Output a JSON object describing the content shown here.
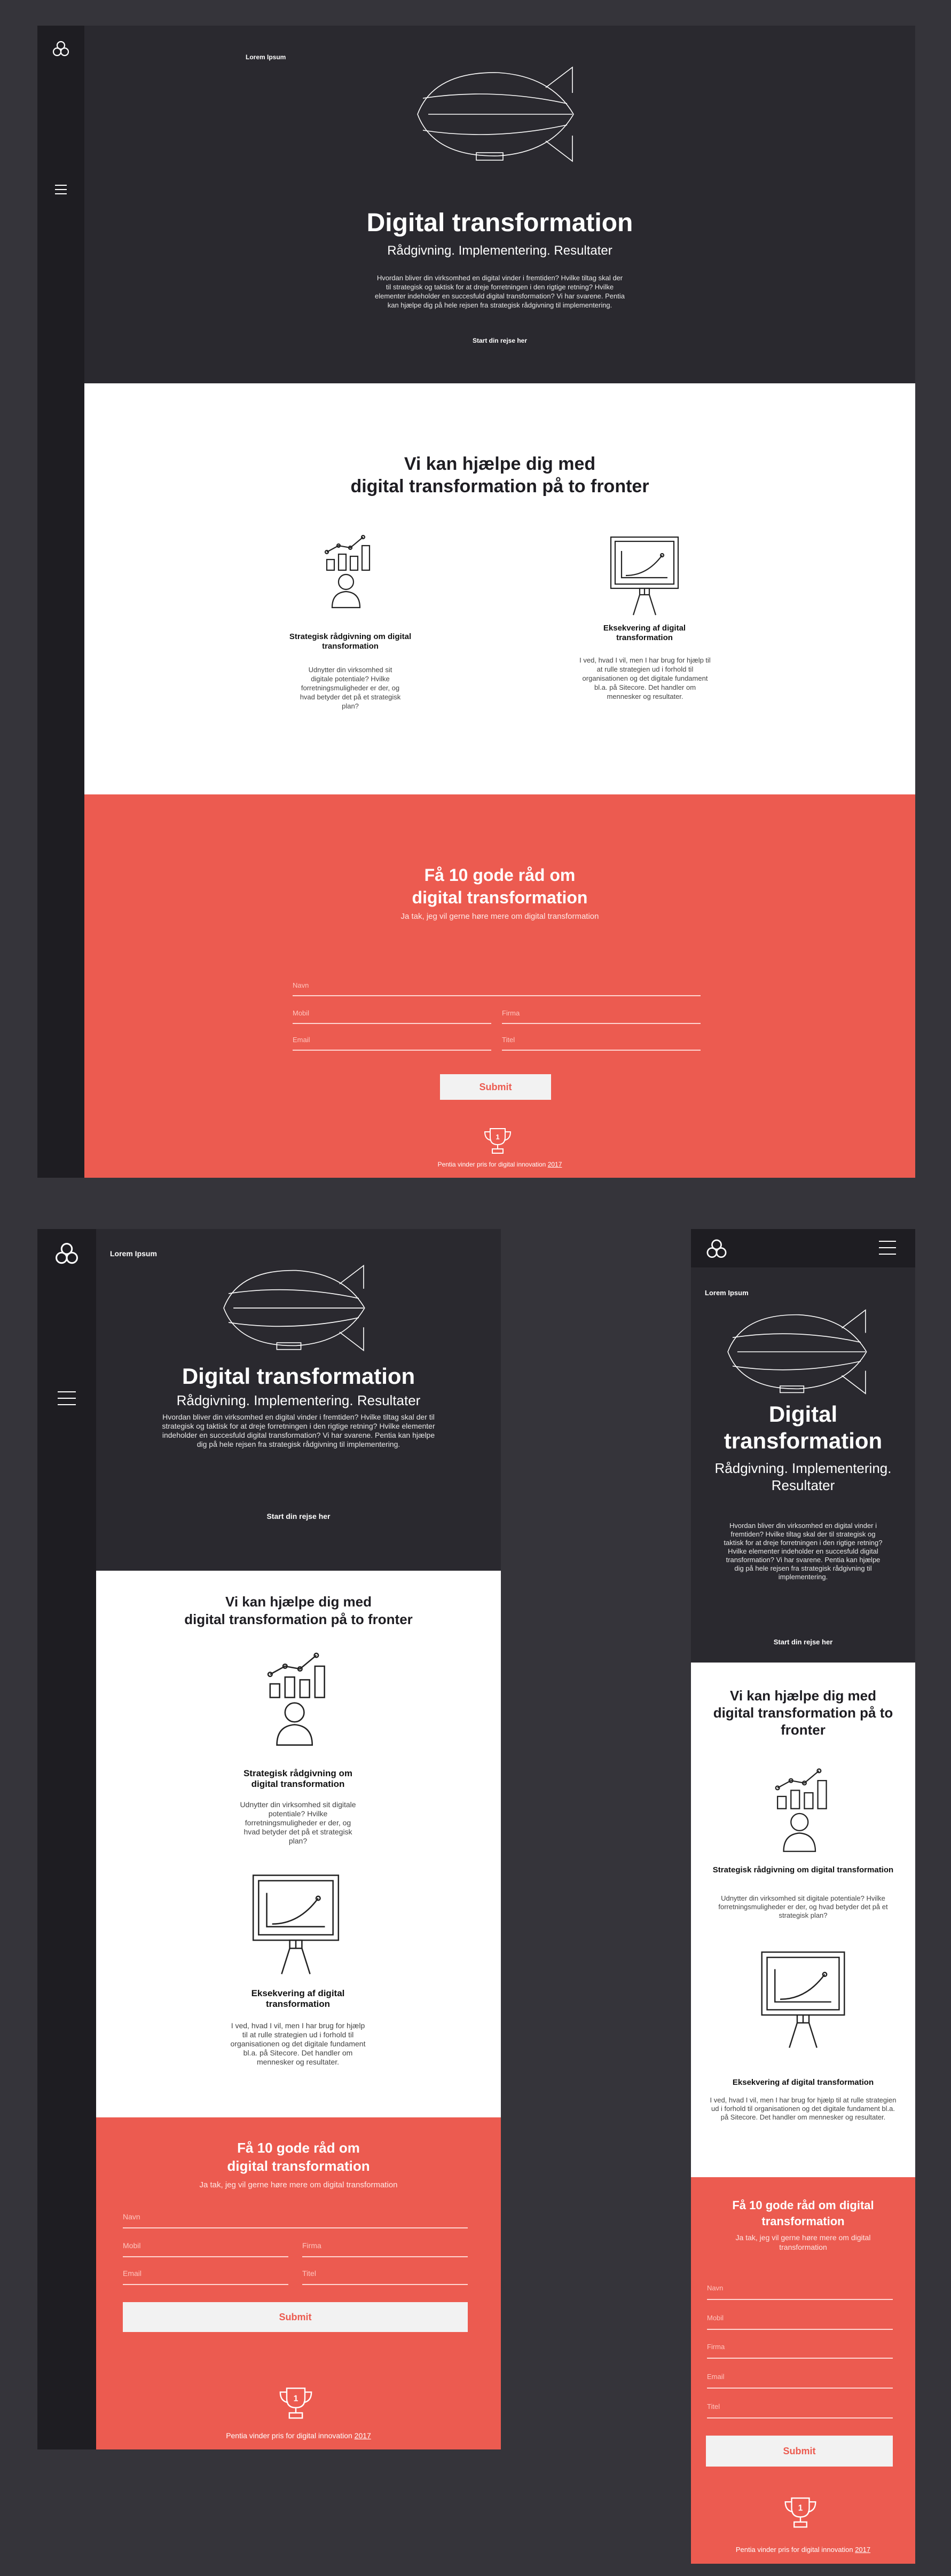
{
  "brand": "Lorem Ipsum",
  "hero": {
    "title": "Digital transformation",
    "subtitle": "Rådgivning. Implementering. Resultater",
    "intro": "Hvordan bliver din virksomhed en digital vinder i fremtiden? Hvilke tiltag skal der til strategisk og taktisk for at dreje forretningen i den rigtige retning? Hvilke elementer indeholder en succesfuld digital transformation? Vi har svarene. Pentia kan hjælpe dig på hele rejsen fra strategisk rådgivning til implementering.",
    "cta": "Start din rejse her"
  },
  "help": {
    "title_line1": "Vi kan hjælpe dig med",
    "title_line2": "digital transformation på to fronter",
    "features": [
      {
        "title": "Strategisk rådgivning om digital transformation",
        "text": "Udnytter din virksomhed sit digitale potentiale? Hvilke forretningsmuligheder er der, og hvad betyder det på et strategisk plan?",
        "icon": "chart-person-icon"
      },
      {
        "title": "Eksekvering af digital transformation",
        "text": "I ved, hvad I vil, men I har brug for hjælp til at rulle strategien ud i forhold til organisationen og det digitale fundament bl.a. på Sitecore. Det handler om mennesker og resultater.",
        "icon": "presentation-board-icon"
      }
    ]
  },
  "form": {
    "title_line1": "Få 10 gode råd om",
    "title_line2": "digital transformation",
    "lead": "Ja tak, jeg vil gerne høre mere om digital transformation",
    "name_placeholder": "Navn",
    "mobile_placeholder": "Mobil",
    "company_placeholder": "Firma",
    "email_placeholder": "Email",
    "title_placeholder": "Titel",
    "submit": "Submit"
  },
  "award": {
    "badge": "1",
    "text": "Pentia vinder pris for digital innovation",
    "year": "2017"
  },
  "colors": {
    "accent": "#ec5b50",
    "dark": "#2a292f",
    "sidebar": "#1e1d22"
  }
}
